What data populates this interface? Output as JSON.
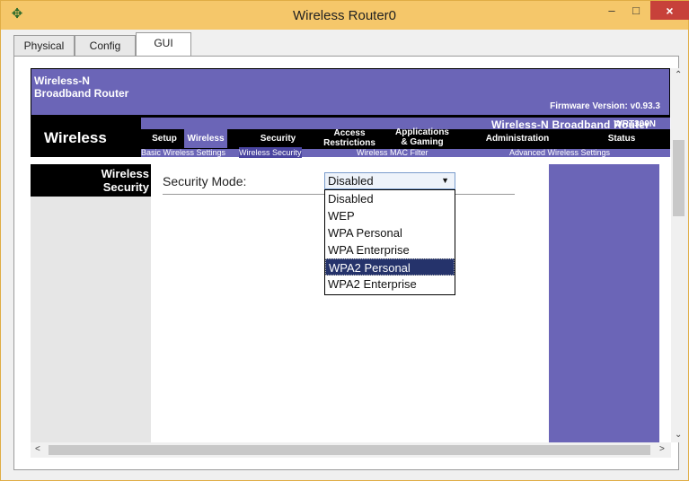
{
  "window": {
    "title": "Wireless Router0",
    "minimize": "–",
    "maximize": "□",
    "close": "×"
  },
  "tabs": [
    {
      "label": "Physical"
    },
    {
      "label": "Config"
    },
    {
      "label": "GUI",
      "active": true
    }
  ],
  "router": {
    "brand_name": "Wireless-N\nBroadband Router",
    "firmware": "Firmware Version: v0.93.3",
    "product": "Wireless-N Broadband Router",
    "model": "WRT300N",
    "section": "Wireless",
    "nav_tabs": [
      {
        "label": "Setup"
      },
      {
        "label": "Wireless",
        "active": true
      },
      {
        "label": "Security"
      },
      {
        "label": "Access\nRestrictions"
      },
      {
        "label": "Applications\n& Gaming"
      },
      {
        "label": "Administration"
      },
      {
        "label": "Status"
      }
    ],
    "sub_links": [
      {
        "label": "Basic Wireless Settings"
      },
      {
        "label": "Wireless Security",
        "active": true
      },
      {
        "label": "Wireless MAC Filter"
      },
      {
        "label": "Advanced Wireless Settings"
      }
    ],
    "left_heading": "Wireless\nSecurity",
    "security_mode": {
      "label": "Security Mode:",
      "selected": "Disabled",
      "options": [
        "Disabled",
        "WEP",
        "WPA Personal",
        "WPA Enterprise",
        "WPA2 Personal",
        "WPA2 Enterprise"
      ],
      "highlighted": "WPA2 Personal"
    }
  },
  "colors": {
    "accent": "#6b65b7",
    "titlebar": "#f5c76a",
    "close": "#c7413a",
    "highlight": "#25336b"
  }
}
